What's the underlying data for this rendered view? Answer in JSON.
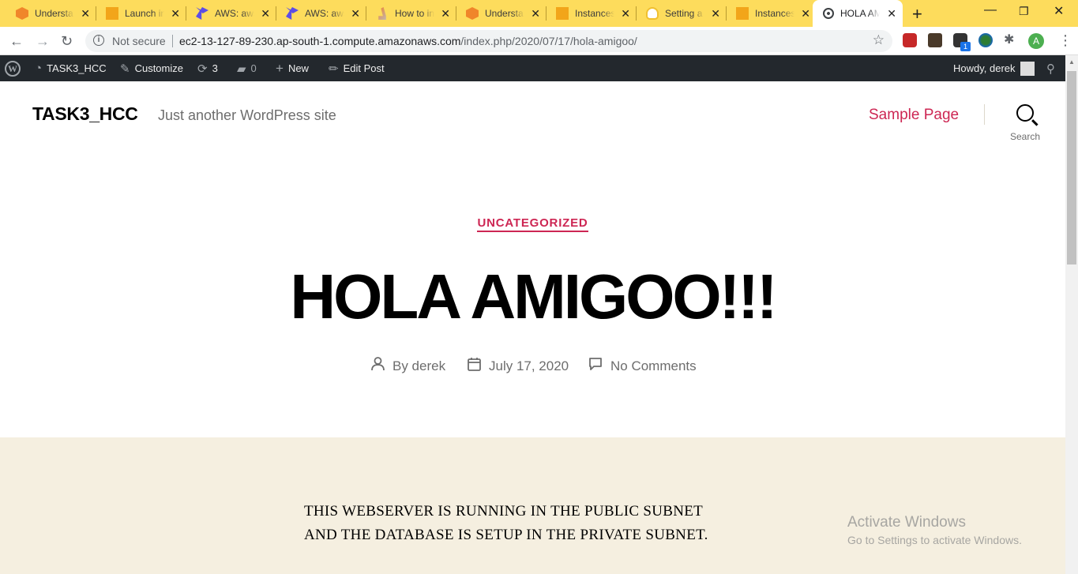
{
  "browser": {
    "tabs": [
      {
        "title": "Understa",
        "icon": "aws-box-icon",
        "color": "#f0862a"
      },
      {
        "title": "Launch in",
        "icon": "aws-ec2-icon",
        "color": "#f2a51a"
      },
      {
        "title": "AWS: aws",
        "icon": "terraform-icon",
        "color": "#5c4ee5"
      },
      {
        "title": "AWS: aws",
        "icon": "terraform-icon",
        "color": "#5c4ee5"
      },
      {
        "title": "How to in",
        "icon": "stackoverflow-icon",
        "color": "#e87b2a"
      },
      {
        "title": "Understa",
        "icon": "aws-box-icon",
        "color": "#f0862a"
      },
      {
        "title": "Instances",
        "icon": "aws-ec2-icon",
        "color": "#f2a51a"
      },
      {
        "title": "Setting a",
        "icon": "lightbulb-icon",
        "color": "#f0c030"
      },
      {
        "title": "Instances",
        "icon": "aws-ec2-icon",
        "color": "#f2a51a"
      },
      {
        "title": "HOLA AM",
        "icon": "globe-icon",
        "color": "#3c4043"
      }
    ],
    "security_label": "Not secure",
    "url_host": "ec2-13-127-89-230.ap-south-1.compute.amazonaws.com",
    "url_path": "/index.php/2020/07/17/hola-amigoo/",
    "profile_initial": "A",
    "extension_badge": "1"
  },
  "adminbar": {
    "site_name": "TASK3_HCC",
    "customize": "Customize",
    "updates_count": "3",
    "comments_count": "0",
    "new": "New",
    "edit_post": "Edit Post",
    "howdy": "Howdy, derek"
  },
  "site": {
    "title": "TASK3_HCC",
    "description": "Just another WordPress site",
    "menu_item": "Sample Page",
    "search_label": "Search",
    "accent_color": "#cd2653"
  },
  "post": {
    "category": "UNCATEGORIZED",
    "title": "HOLA AMIGOO!!!",
    "author": "By derek",
    "date": "July 17, 2020",
    "comments": "No Comments",
    "content_lines": [
      "THIS WEBSERVER IS RUNNING IN THE PUBLIC SUBNET",
      "AND THE DATABASE IS SETUP IN THE PRIVATE SUBNET."
    ]
  },
  "watermark": {
    "title": "Activate Windows",
    "subtitle": "Go to Settings to activate Windows."
  }
}
